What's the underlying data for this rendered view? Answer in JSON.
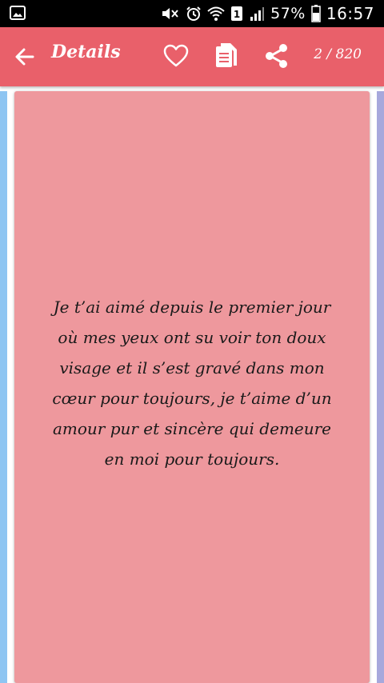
{
  "status_bar": {
    "battery_percent": "57%",
    "time": "16:57",
    "sim_slot": "1",
    "icons": [
      "image-notification-icon",
      "mute-icon",
      "alarm-icon",
      "wifi-icon",
      "sim-icon",
      "signal-icon",
      "battery-icon"
    ]
  },
  "app_bar": {
    "title": "Details",
    "page_counter": "2 / 820",
    "background_color": "#e9606a",
    "icons": [
      "back-arrow-icon",
      "heart-icon",
      "copy-icon",
      "share-icon"
    ]
  },
  "card": {
    "background_color": "#ee989d",
    "quote": "Je t’ai aimé depuis le premier jour où mes yeux ont su voir ton doux visage et il s’est gravé dans mon cœur pour toujours, je t’aime d’un amour pur et sincère qui demeure en moi pour toujours."
  }
}
